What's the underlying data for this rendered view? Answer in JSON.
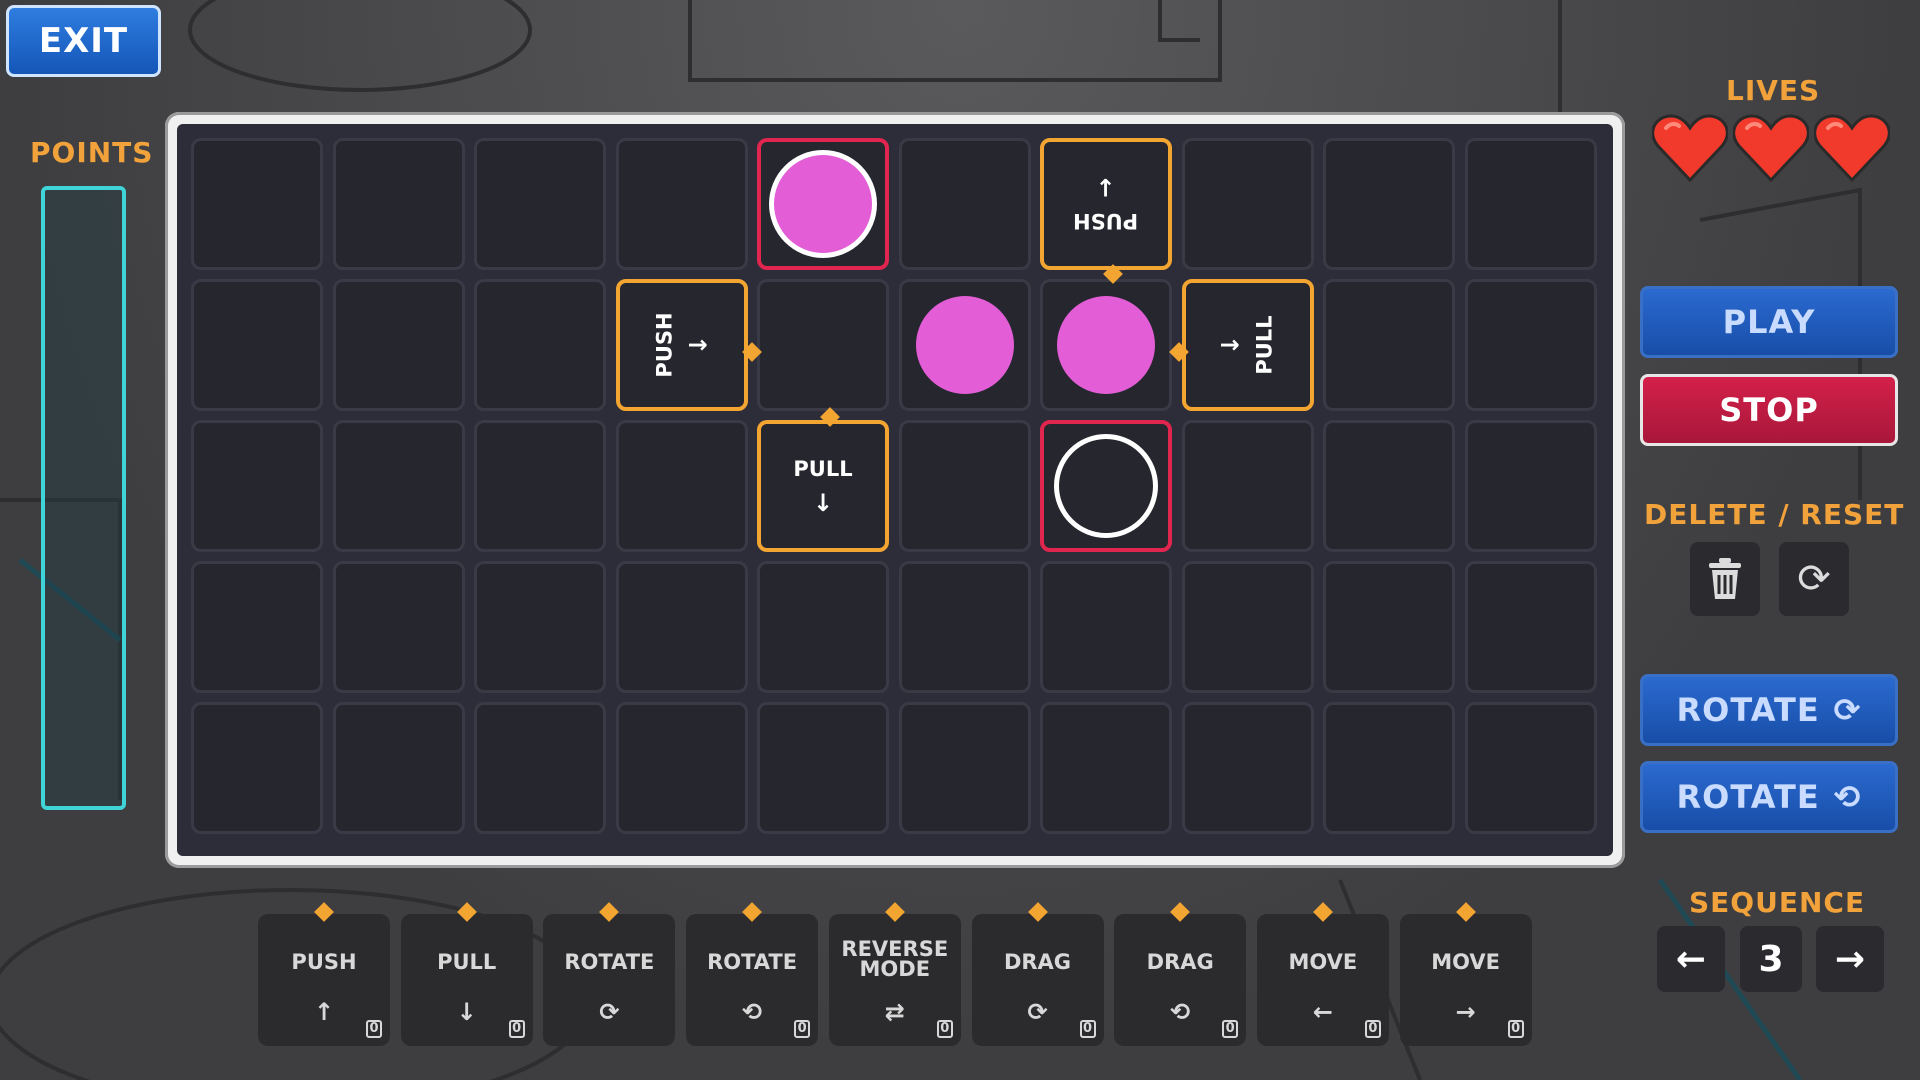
{
  "exit_label": "EXIT",
  "points_label": "POINTS",
  "lives_label": "LIVES",
  "lives_count": 3,
  "play_label": "PLAY",
  "stop_label": "STOP",
  "delete_reset_label": "DELETE / RESET",
  "rotate_cw_label": "ROTATE",
  "rotate_ccw_label": "ROTATE",
  "sequence_label": "SEQUENCE",
  "sequence_value": "3",
  "board": {
    "cols": 10,
    "rows": 5,
    "tiles": [
      {
        "label": "PUSH",
        "arrow": "↓"
      },
      {
        "label": "PUSH",
        "arrow": "→"
      },
      {
        "label": "PULL",
        "arrow": "→"
      },
      {
        "label": "PULL",
        "arrow": "↓"
      }
    ]
  },
  "palette": [
    {
      "label": "PUSH",
      "icon": "↑",
      "count": "0"
    },
    {
      "label": "PULL",
      "icon": "↓",
      "count": "0"
    },
    {
      "label": "ROTATE",
      "icon": "⟳",
      "count": ""
    },
    {
      "label": "ROTATE",
      "icon": "⟲",
      "count": "0"
    },
    {
      "label": "REVERSE MODE",
      "icon": "⇄",
      "count": "0"
    },
    {
      "label": "DRAG",
      "icon": "⟳",
      "count": "0"
    },
    {
      "label": "DRAG",
      "icon": "⟲",
      "count": "0"
    },
    {
      "label": "MOVE",
      "icon": "←",
      "count": "0"
    },
    {
      "label": "MOVE",
      "icon": "→",
      "count": "0"
    }
  ],
  "colors": {
    "accent_orange": "#f3a531",
    "target_red": "#e0264e",
    "ball_magenta": "#e35ed6",
    "points_cyan": "#3fd4d8"
  }
}
